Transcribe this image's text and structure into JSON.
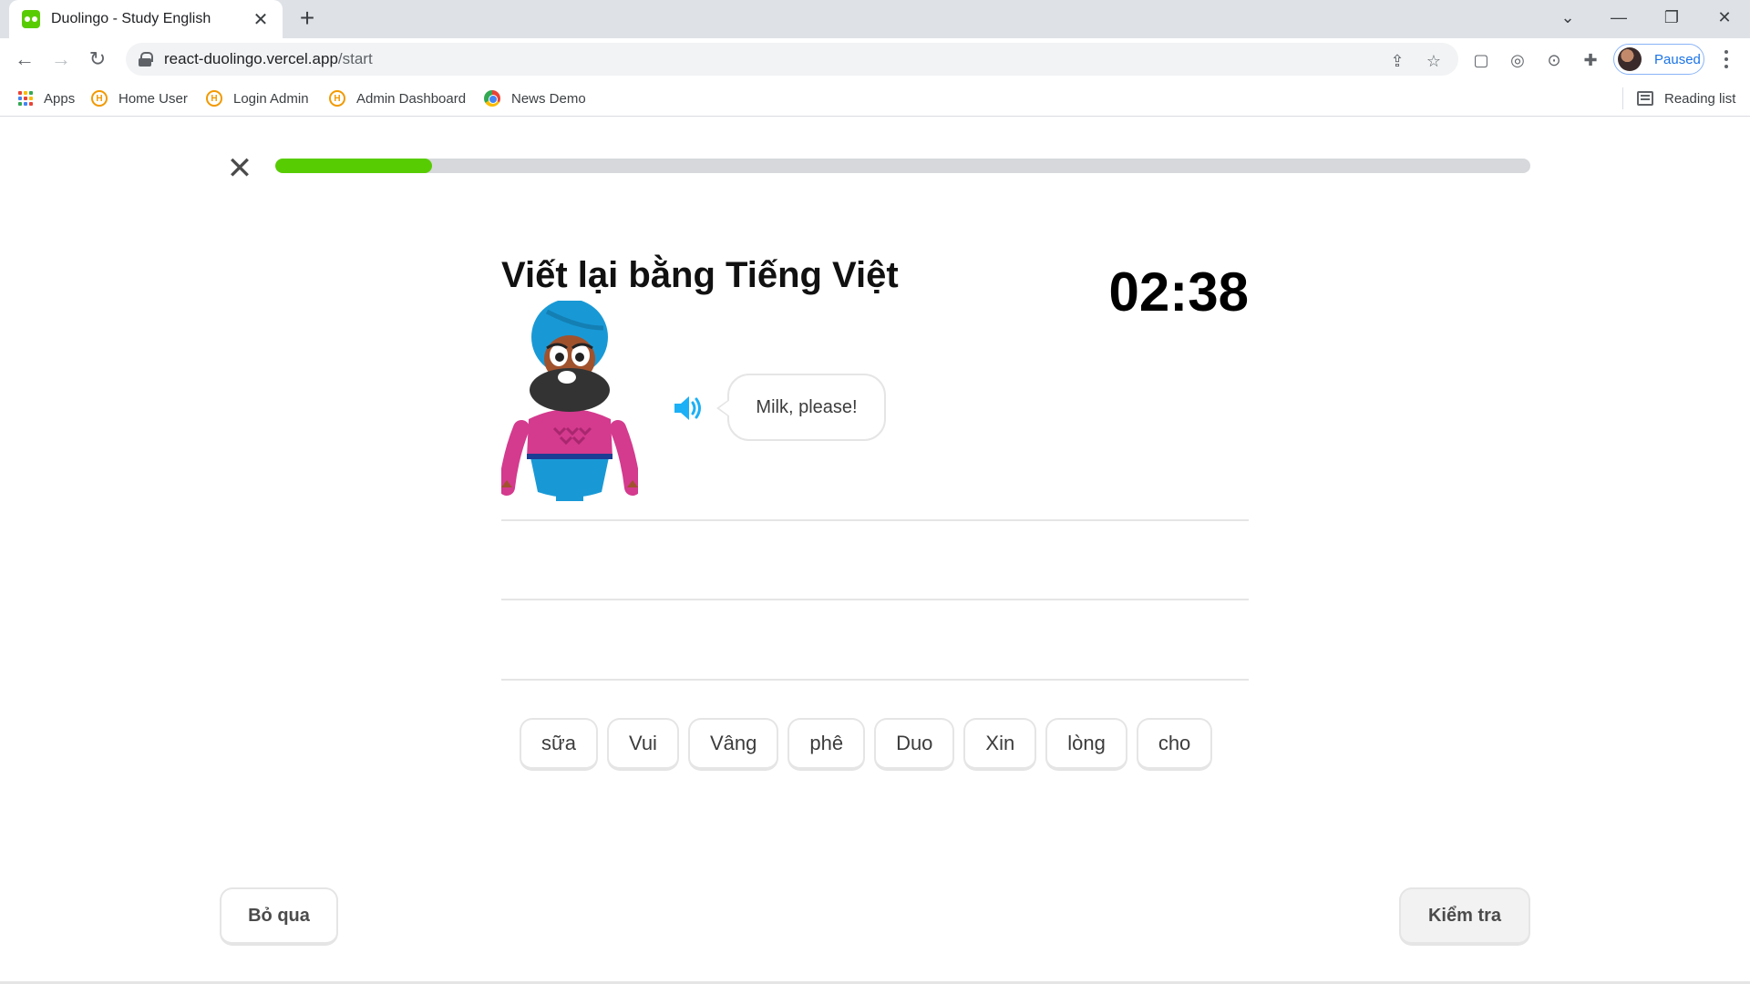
{
  "browser": {
    "tab_title": "Duolingo - Study English",
    "url_host": "react-duolingo.vercel.app",
    "url_path": "/start",
    "profile_status": "Paused",
    "bookmarks": [
      "Apps",
      "Home User",
      "Login Admin",
      "Admin Dashboard",
      "News Demo"
    ],
    "reading_list": "Reading list"
  },
  "lesson": {
    "progress_fraction": 0.125,
    "title": "Viết lại bằng Tiếng Việt",
    "timer": "02:38",
    "sentence": "Milk, please!",
    "word_bank": [
      "sữa",
      "Vui",
      "Vâng",
      "phê",
      "Duo",
      "Xin",
      "lòng",
      "cho"
    ],
    "skip_label": "Bỏ qua",
    "check_label": "Kiểm tra"
  },
  "colors": {
    "progress": "#58cc02",
    "speaker": "#1cb0f6",
    "track": "#d6d8db"
  }
}
